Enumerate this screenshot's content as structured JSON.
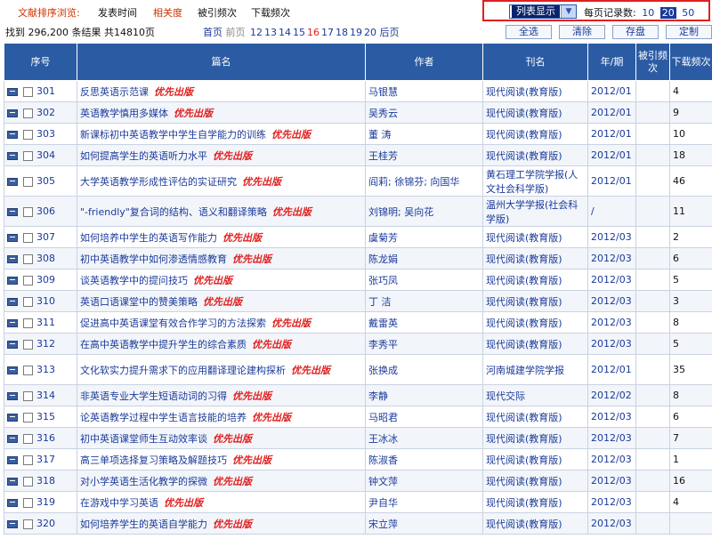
{
  "sort": {
    "label": "文献排序浏览:",
    "options": [
      "发表时间",
      "相关度",
      "被引频次",
      "下载频次"
    ],
    "active": 1
  },
  "view": {
    "selected": "列表显示",
    "perpage_label": "每页记录数:",
    "perpage_options": [
      "10",
      "20",
      "50"
    ],
    "perpage_selected": "20"
  },
  "results": {
    "found": "找到 296,200 条结果 共14810页",
    "first": "首页",
    "prev": "前页",
    "pages": [
      "12",
      "13",
      "14",
      "15",
      "16",
      "17",
      "18",
      "19",
      "20"
    ],
    "current_page": "16",
    "next": "后页"
  },
  "buttons": {
    "select_all": "全选",
    "clear": "清除",
    "save": "存盘",
    "custom": "定制"
  },
  "columns": [
    "序号",
    "篇名",
    "作者",
    "刊名",
    "年/期",
    "被引频次",
    "下载频次"
  ],
  "priority_tag": "优先出版",
  "colors": {
    "header": "#2b5ba3",
    "link": "#1a3a9a",
    "accent": "#e02020"
  },
  "rows": [
    {
      "no": "301",
      "title": "反思英语示范课",
      "prio": true,
      "author": "马银慧",
      "journal": "现代阅读(教育版)",
      "issue": "2012/01",
      "cited": "",
      "downloads": "4"
    },
    {
      "no": "302",
      "title": "英语教学慎用多媒体",
      "prio": true,
      "author": "吴秀云",
      "journal": "现代阅读(教育版)",
      "issue": "2012/01",
      "cited": "",
      "downloads": "9"
    },
    {
      "no": "303",
      "title": "新课标初中英语教学中学生自学能力的训练",
      "prio": true,
      "author": "董 涛",
      "journal": "现代阅读(教育版)",
      "issue": "2012/01",
      "cited": "",
      "downloads": "10"
    },
    {
      "no": "304",
      "title": "如何提高学生的英语听力水平",
      "prio": true,
      "author": "王桂芳",
      "journal": "现代阅读(教育版)",
      "issue": "2012/01",
      "cited": "",
      "downloads": "18"
    },
    {
      "no": "305",
      "title": "大学英语教学形成性评估的实证研究",
      "prio": true,
      "author": "阎莉; 徐锦芬; 向国华",
      "journal": "黄石理工学院学报(人文社会科学版)",
      "issue": "2012/01",
      "cited": "",
      "downloads": "46",
      "tall": true
    },
    {
      "no": "306",
      "title": "\"-friendly\"复合词的结构、语义和翻译策略",
      "prio": true,
      "author": "刘锦明; 吴向花",
      "journal": "温州大学学报(社会科学版)",
      "issue": "/",
      "cited": "",
      "downloads": "11",
      "tall": true
    },
    {
      "no": "307",
      "title": "如何培养中学生的英语写作能力",
      "prio": true,
      "author": "虞菊芳",
      "journal": "现代阅读(教育版)",
      "issue": "2012/03",
      "cited": "",
      "downloads": "2"
    },
    {
      "no": "308",
      "title": "初中英语教学中如何渗透情感教育",
      "prio": true,
      "author": "陈龙娟",
      "journal": "现代阅读(教育版)",
      "issue": "2012/03",
      "cited": "",
      "downloads": "6"
    },
    {
      "no": "309",
      "title": "谈英语教学中的提问技巧",
      "prio": true,
      "author": "张巧凤",
      "journal": "现代阅读(教育版)",
      "issue": "2012/03",
      "cited": "",
      "downloads": "5"
    },
    {
      "no": "310",
      "title": "英语口语课堂中的赞美策略",
      "prio": true,
      "author": "丁 洁",
      "journal": "现代阅读(教育版)",
      "issue": "2012/03",
      "cited": "",
      "downloads": "3"
    },
    {
      "no": "311",
      "title": "促进高中英语课堂有效合作学习的方法探索",
      "prio": true,
      "author": "戴雷英",
      "journal": "现代阅读(教育版)",
      "issue": "2012/03",
      "cited": "",
      "downloads": "8"
    },
    {
      "no": "312",
      "title": "在高中英语教学中提升学生的综合素质",
      "prio": true,
      "author": "李秀平",
      "journal": "现代阅读(教育版)",
      "issue": "2012/03",
      "cited": "",
      "downloads": "5"
    },
    {
      "no": "313",
      "title": "文化软实力提升需求下的应用翻译理论建构探析",
      "prio": true,
      "author": "张换成",
      "journal": "河南城建学院学报",
      "issue": "2012/01",
      "cited": "",
      "downloads": "35",
      "tall": true
    },
    {
      "no": "314",
      "title": "非英语专业大学生短语动词的习得",
      "prio": true,
      "author": "李静",
      "journal": "现代交际",
      "issue": "2012/02",
      "cited": "",
      "downloads": "8"
    },
    {
      "no": "315",
      "title": "论英语教学过程中学生语言技能的培养",
      "prio": true,
      "author": "马昭君",
      "journal": "现代阅读(教育版)",
      "issue": "2012/03",
      "cited": "",
      "downloads": "6"
    },
    {
      "no": "316",
      "title": "初中英语课堂师生互动效率谈",
      "prio": true,
      "author": "王冰冰",
      "journal": "现代阅读(教育版)",
      "issue": "2012/03",
      "cited": "",
      "downloads": "7"
    },
    {
      "no": "317",
      "title": "高三单项选择复习策略及解题技巧",
      "prio": true,
      "author": "陈淑香",
      "journal": "现代阅读(教育版)",
      "issue": "2012/03",
      "cited": "",
      "downloads": "1"
    },
    {
      "no": "318",
      "title": "对小学英语生活化教学的探微",
      "prio": true,
      "author": "钟文萍",
      "journal": "现代阅读(教育版)",
      "issue": "2012/03",
      "cited": "",
      "downloads": "16"
    },
    {
      "no": "319",
      "title": "在游戏中学习英语",
      "prio": true,
      "author": "尹自华",
      "journal": "现代阅读(教育版)",
      "issue": "2012/03",
      "cited": "",
      "downloads": "4"
    },
    {
      "no": "320",
      "title": "如何培养学生的英语自学能力",
      "prio": true,
      "author": "宋立萍",
      "journal": "现代阅读(教育版)",
      "issue": "2012/03",
      "cited": "",
      "downloads": ""
    }
  ]
}
